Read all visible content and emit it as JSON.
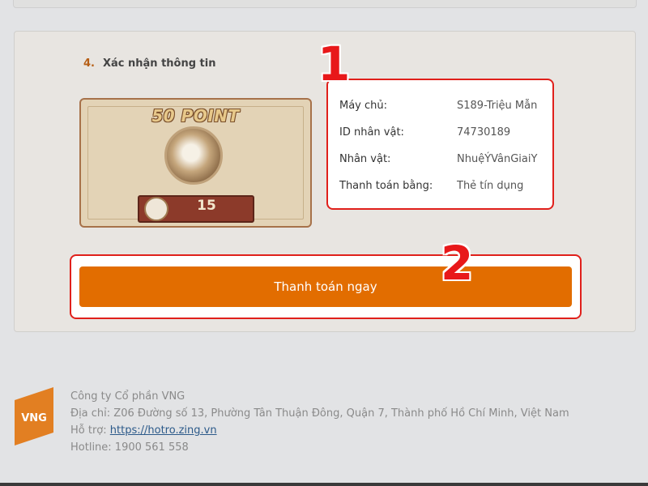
{
  "step": {
    "number": "4.",
    "title": "Xác nhận thông tin"
  },
  "package": {
    "title": "50 POINT",
    "price": "15"
  },
  "info": {
    "rows": [
      {
        "label": "Máy chủ:",
        "value": "S189-Triệu Mẫn"
      },
      {
        "label": "ID nhân vật:",
        "value": "74730189"
      },
      {
        "label": "Nhân vật:",
        "value": "NhuệÝVânGiaiY"
      },
      {
        "label": "Thanh toán bằng:",
        "value": "Thẻ tín dụng"
      }
    ]
  },
  "annotations": {
    "one": "1",
    "two": "2"
  },
  "pay_button": {
    "label": "Thanh toán ngay"
  },
  "footer": {
    "logo_text": "VNG",
    "company": "Công ty Cổ phần VNG",
    "address": "Địa chỉ: Z06 Đường số 13, Phường Tân Thuận Đông, Quận 7, Thành phố Hồ Chí Minh, Việt Nam",
    "support_label": "Hỗ trợ: ",
    "support_link": "https://hotro.zing.vn",
    "hotline": "Hotline: 1900 561 558"
  },
  "colors": {
    "accent": "#e26d00",
    "highlight": "#e0201b",
    "step_number": "#b65f16"
  }
}
